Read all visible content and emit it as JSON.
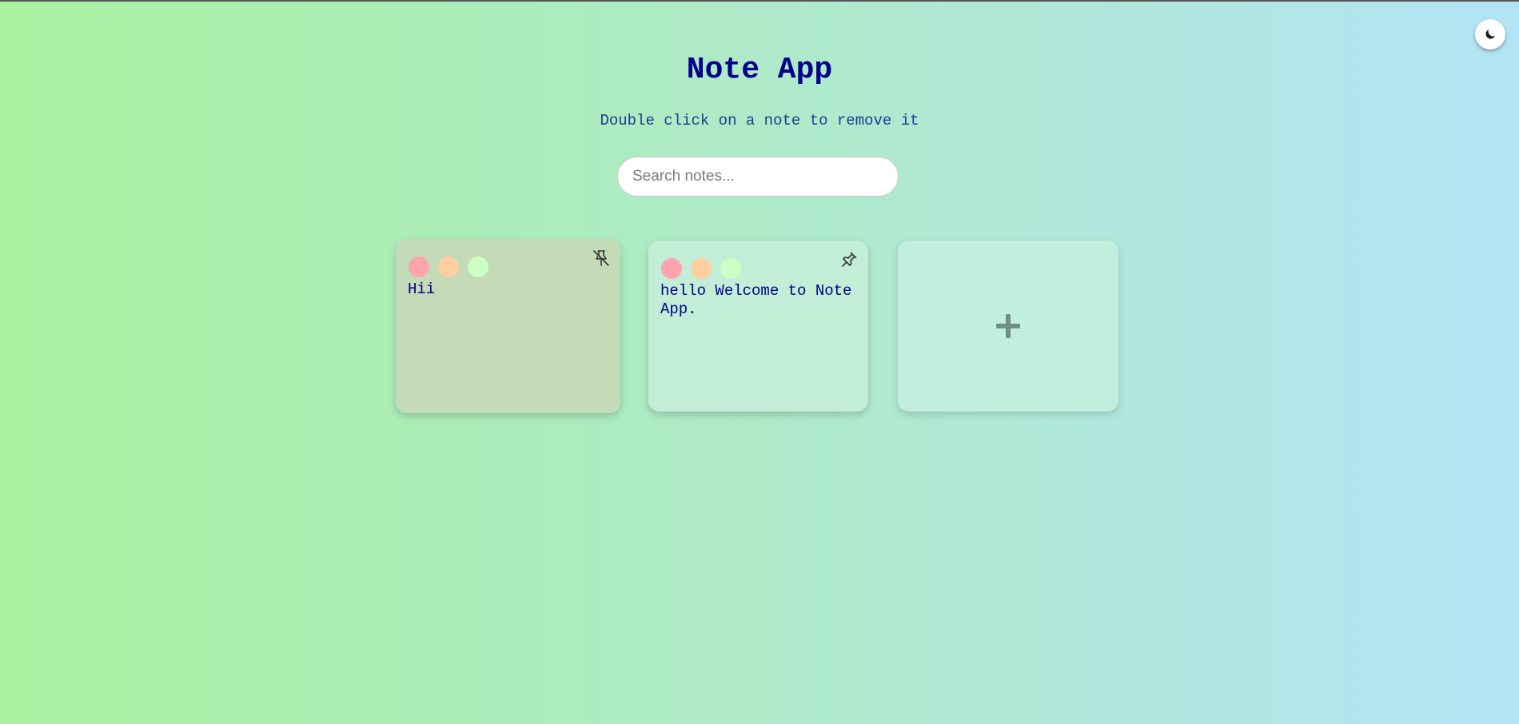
{
  "app": {
    "title": "Note App",
    "subtitle": "Double click on a note to remove it"
  },
  "theme_toggle": {
    "icon": "moon-icon"
  },
  "search": {
    "placeholder": "Search notes...",
    "value": ""
  },
  "notes": [
    {
      "text": "Hii",
      "pinned": true,
      "pin_icon": "unpin-icon",
      "background": "#c3dbb7",
      "colors": [
        "#ffa3ad",
        "#ffcfa2",
        "#cdffc4"
      ]
    },
    {
      "text": "hello Welcome to Note App.",
      "pinned": false,
      "pin_icon": "pin-icon",
      "background": "#c2eed8",
      "colors": [
        "#ffa3ad",
        "#ffcfa2",
        "#cdffc4"
      ]
    }
  ],
  "add_button": {
    "icon": "plus-icon"
  },
  "colors": {
    "title": "#00008b",
    "subtitle": "#1f3c8f",
    "note_text": "#00008b",
    "gradient_start": "#a9f0a0",
    "gradient_end": "#b3e4f5"
  }
}
